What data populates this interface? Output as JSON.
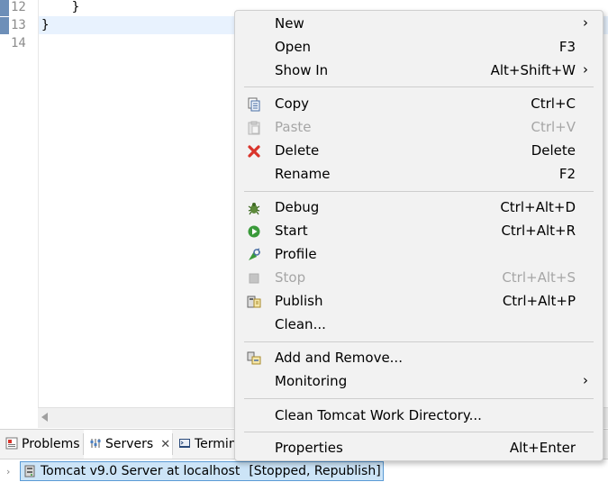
{
  "editor": {
    "lines": [
      {
        "num": "12",
        "code": "    }"
      },
      {
        "num": "13",
        "code": "}"
      },
      {
        "num": "14",
        "code": ""
      }
    ]
  },
  "panel": {
    "tabs": [
      {
        "label": "Problems",
        "icon": "problems-icon",
        "active": false
      },
      {
        "label": "Servers",
        "icon": "servers-icon",
        "active": true,
        "close": "✕"
      },
      {
        "label": "Termin",
        "icon": "terminal-icon",
        "active": false
      }
    ],
    "server": {
      "name": "Tomcat v9.0 Server at localhost",
      "status": "[Stopped, Republish]"
    }
  },
  "menu": {
    "groups": [
      [
        {
          "label": "New",
          "shortcut": "",
          "submenu": true,
          "icon": "",
          "disabled": false
        },
        {
          "label": "Open",
          "shortcut": "F3",
          "submenu": false,
          "icon": "",
          "disabled": false
        },
        {
          "label": "Show In",
          "shortcut": "Alt+Shift+W",
          "submenu": true,
          "icon": "",
          "disabled": false
        }
      ],
      [
        {
          "label": "Copy",
          "shortcut": "Ctrl+C",
          "submenu": false,
          "icon": "copy-icon",
          "disabled": false
        },
        {
          "label": "Paste",
          "shortcut": "Ctrl+V",
          "submenu": false,
          "icon": "paste-icon",
          "disabled": true
        },
        {
          "label": "Delete",
          "shortcut": "Delete",
          "submenu": false,
          "icon": "delete-icon",
          "disabled": false
        },
        {
          "label": "Rename",
          "shortcut": "F2",
          "submenu": false,
          "icon": "",
          "disabled": false
        }
      ],
      [
        {
          "label": "Debug",
          "shortcut": "Ctrl+Alt+D",
          "submenu": false,
          "icon": "debug-icon",
          "disabled": false
        },
        {
          "label": "Start",
          "shortcut": "Ctrl+Alt+R",
          "submenu": false,
          "icon": "start-icon",
          "disabled": false
        },
        {
          "label": "Profile",
          "shortcut": "",
          "submenu": false,
          "icon": "profile-icon",
          "disabled": false
        },
        {
          "label": "Stop",
          "shortcut": "Ctrl+Alt+S",
          "submenu": false,
          "icon": "stop-icon",
          "disabled": true
        },
        {
          "label": "Publish",
          "shortcut": "Ctrl+Alt+P",
          "submenu": false,
          "icon": "publish-icon",
          "disabled": false
        },
        {
          "label": "Clean...",
          "shortcut": "",
          "submenu": false,
          "icon": "",
          "disabled": false
        }
      ],
      [
        {
          "label": "Add and Remove...",
          "shortcut": "",
          "submenu": false,
          "icon": "add-remove-icon",
          "disabled": false
        },
        {
          "label": "Monitoring",
          "shortcut": "",
          "submenu": true,
          "icon": "",
          "disabled": false
        }
      ],
      [
        {
          "label": "Clean Tomcat Work Directory...",
          "shortcut": "",
          "submenu": false,
          "icon": "",
          "disabled": false
        }
      ],
      [
        {
          "label": "Properties",
          "shortcut": "Alt+Enter",
          "submenu": false,
          "icon": "",
          "disabled": false
        }
      ]
    ],
    "submenu_arrow": "›"
  },
  "colors": {
    "menu_bg": "#f2f2f2",
    "selection_bg": "#cce4f7",
    "selection_border": "#5a9bd5",
    "delete_red": "#d9342b",
    "start_green": "#3a9a3a",
    "disabled_text": "#a6a6a6"
  }
}
